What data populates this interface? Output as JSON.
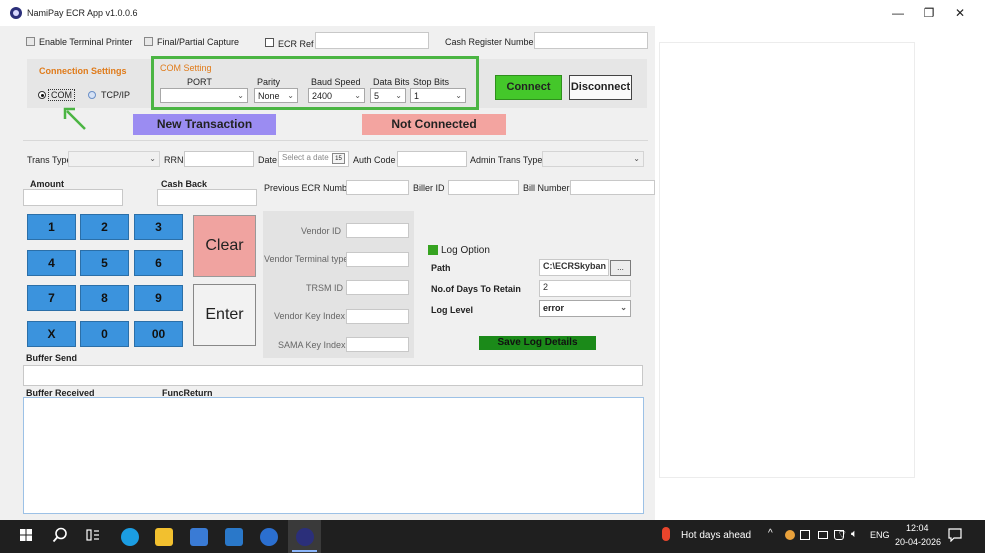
{
  "window": {
    "title": "NamiPay ECR App v1.0.0.6",
    "minimize": "—",
    "restore": "❐",
    "close": "✕"
  },
  "top_options": {
    "enable_printer": "Enable Terminal Printer",
    "final_partial": "Final/Partial Capture",
    "ecr_ref": "ECR Ref",
    "cash_register": "Cash Register Number"
  },
  "connection": {
    "title": "Connection Settings",
    "com_label": "COM",
    "tcp_label": "TCP/IP",
    "selected": "COM"
  },
  "com_setting": {
    "title": "COM Setting",
    "port_label": "PORT",
    "port_value": "",
    "parity_label": "Parity",
    "parity_value": "None",
    "baud_label": "Baud Speed",
    "baud_value": "2400",
    "databits_label": "Data Bits",
    "databits_value": "5",
    "stopbits_label": "Stop Bits",
    "stopbits_value": "1"
  },
  "buttons": {
    "connect": "Connect",
    "disconnect": "Disconnect",
    "clear": "Clear",
    "enter": "Enter",
    "save_log": "Save Log Details"
  },
  "status": {
    "new_transaction": "New Transaction",
    "connection_status": "Not Connected"
  },
  "filters": {
    "trans_type": "Trans Type",
    "rrn": "RRN",
    "date": "Date",
    "date_placeholder": "Select a date",
    "calendar_day": "15",
    "auth_code": "Auth Code",
    "admin_trans_type": "Admin Trans Type"
  },
  "fields": {
    "amount": "Amount",
    "cash_back": "Cash Back",
    "previous_ecr": "Previous ECR Number",
    "biller_id": "Biller ID",
    "bill_number": "Bill Number"
  },
  "keypad": [
    "1",
    "2",
    "3",
    "4",
    "5",
    "6",
    "7",
    "8",
    "9",
    "X",
    "0",
    "00"
  ],
  "vendor": {
    "vendor_id": "Vendor ID",
    "vendor_terminal_type": "Vendor Terminal type",
    "trsm_id": "TRSM ID",
    "vendor_key_index": "Vendor Key Index",
    "sama_key_index": "SAMA Key Index"
  },
  "log": {
    "option_label": "Log Option",
    "path_label": "Path",
    "path_value": "C:\\ECRSkyban",
    "browse": "...",
    "days_label": "No.of Days To Retain",
    "days_value": "2",
    "level_label": "Log Level",
    "level_value": "error"
  },
  "buffers": {
    "send": "Buffer Send",
    "received": "Buffer Received",
    "func_return": "FuncReturn"
  },
  "taskbar": {
    "weather": "Hot days ahead",
    "lang": "ENG",
    "time": "12:04",
    "date": "20-04-2026"
  },
  "colors": {
    "connect_green": "#44c72a",
    "com_box_green": "#4bb543",
    "new_txn_purple": "#9b8cf2",
    "not_connected_red": "#f3a4a0",
    "keypad_blue": "#3b93dd",
    "clear_red": "#f0a3a0",
    "save_log_green": "#1b8a19",
    "orange_label": "#e07b1a"
  }
}
